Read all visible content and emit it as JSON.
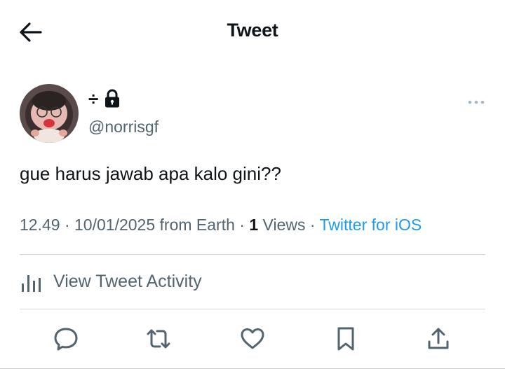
{
  "header": {
    "title": "Tweet",
    "back_icon": "arrow-left-icon"
  },
  "author": {
    "display_name": "÷",
    "protected_icon": "lock-icon",
    "handle": "@norrisgf",
    "more_icon": "more-horizontal-icon"
  },
  "tweet": {
    "text": "gue harus jawab apa kalo gini??",
    "time": "12.49",
    "date": "10/01/2025",
    "location": "from Earth",
    "views_count": "1",
    "views_label": "Views",
    "source": "Twitter for iOS"
  },
  "activity": {
    "label": "View Tweet Activity",
    "icon": "bar-chart-icon"
  },
  "actions": {
    "reply_icon": "reply-icon",
    "retweet_icon": "retweet-icon",
    "like_icon": "heart-icon",
    "bookmark_icon": "bookmark-icon",
    "share_icon": "share-icon"
  },
  "colors": {
    "text": "#0f1419",
    "secondary": "#536471",
    "link": "#1d9bf0",
    "divider": "#cfd9de"
  }
}
